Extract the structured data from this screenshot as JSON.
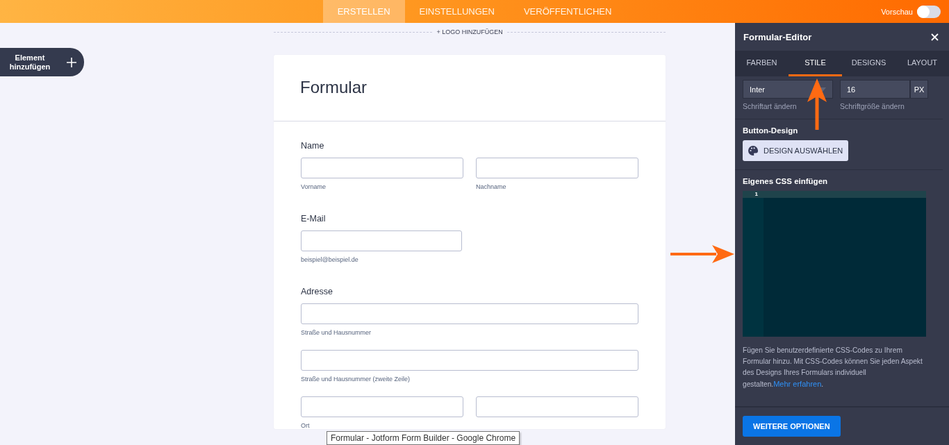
{
  "top_nav": {
    "tabs": [
      {
        "label": "ERSTELLEN",
        "selected": true
      },
      {
        "label": "EINSTELLUNGEN",
        "selected": false
      },
      {
        "label": "VERÖFFENTLICHEN",
        "selected": false
      }
    ],
    "preview": {
      "label": "Vorschau",
      "on": false
    }
  },
  "logo_link": "+ LOGO HINZUFÜGEN",
  "add_element": "Element hinzufügen",
  "form": {
    "title": "Formular",
    "fields": [
      {
        "label": "Name",
        "rows": [
          {
            "kind": "pair",
            "sublabels": [
              "Vorname",
              "Nachname"
            ]
          }
        ]
      },
      {
        "label": "E-Mail",
        "rows": [
          {
            "kind": "half",
            "sublabels": [
              "beispiel@beispiel.de"
            ]
          }
        ]
      },
      {
        "label": "Adresse",
        "rows": [
          {
            "kind": "full",
            "sublabels": [
              "Straße und Hausnummer"
            ]
          },
          {
            "kind": "full",
            "sublabels": [
              "Straße und Hausnummer (zweite Zeile)"
            ]
          },
          {
            "kind": "pair",
            "sublabels": [
              "Ort"
            ]
          }
        ]
      }
    ]
  },
  "panel": {
    "title": "Formular-Editor",
    "tabs": [
      {
        "label": "FARBEN",
        "selected": false
      },
      {
        "label": "STILE",
        "selected": true
      },
      {
        "label": "DESIGNS",
        "selected": false
      },
      {
        "label": "LAYOUT",
        "selected": false
      }
    ],
    "font": {
      "value": "Inter",
      "hint": "Schriftart ändern"
    },
    "font_size": {
      "value": "16",
      "unit": "PX",
      "hint": "Schriftgröße ändern"
    },
    "button_design": {
      "heading": "Button-Design",
      "button": "DESIGN AUSWÄHLEN"
    },
    "css": {
      "heading": "Eigenes CSS einfügen",
      "line_numbers": [
        "1"
      ],
      "description": "Fügen Sie benutzerdefinierte CSS-Codes zu Ihrem Formular hinzu. Mit CSS-Codes können Sie jeden Aspekt des Designs Ihres Formulars individuell gestalten.",
      "link": "Mehr erfahren",
      "after_link": "."
    },
    "footer_button": "WEITERE OPTIONEN"
  },
  "tooltip": "Formular - Jotform Form Builder - Google Chrome"
}
